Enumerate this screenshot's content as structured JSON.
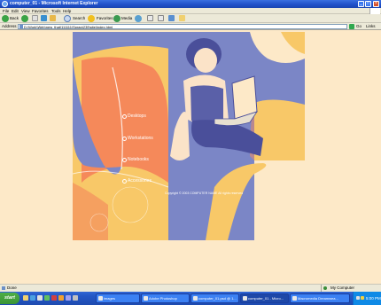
{
  "window": {
    "title": "computer_01 - Microsoft Internet Explorer"
  },
  "menu": [
    "File",
    "Edit",
    "View",
    "Favorites",
    "Tools",
    "Help"
  ],
  "toolbar": {
    "back_label": "Back",
    "search_label": "Search",
    "favorites_label": "Favorites",
    "media_label": "Media"
  },
  "address": {
    "label": "Address",
    "url": "D:\\Work\\Web\\new_that\\111111\\Sprag\\239\\site\\index.html",
    "go_label": "Go",
    "links_label": "Links"
  },
  "site": {
    "nav": [
      "Desktops",
      "Workstations",
      "Notebooks",
      "Accessories"
    ],
    "copyright": "Copyright © 2003 COMPUTER NAME  All rights reserved",
    "colors": {
      "blue": "#7b86c6",
      "orange": "#f5895a",
      "yellow": "#f8c868",
      "cream": "#fde9c8"
    }
  },
  "status": {
    "text": "Done",
    "zone": "My Computer"
  },
  "taskbar": {
    "start_label": "start",
    "tasks": [
      "images",
      "Adobe Photoshop",
      "computer_01.psd @ 1...",
      "computer_01 - Micro...",
      "Macromedia Dreamwea..."
    ],
    "clock": "5:00 PM"
  }
}
